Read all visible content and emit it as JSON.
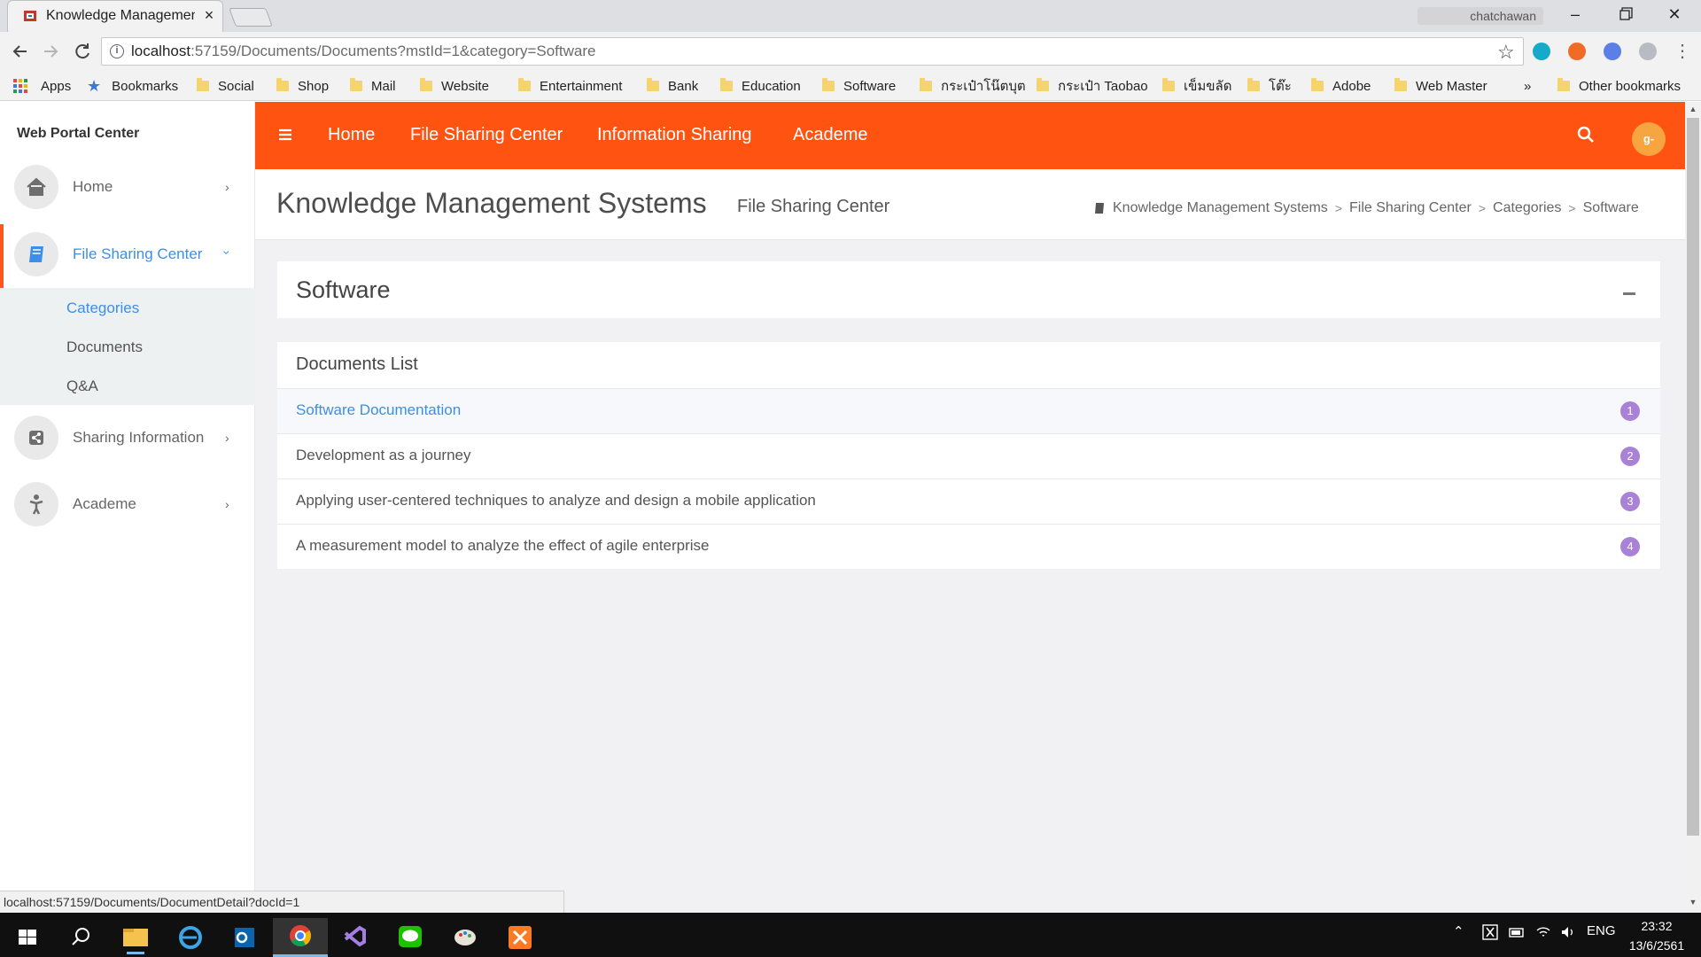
{
  "browser": {
    "tab_title": "Knowledge Management Systems",
    "tab_close": "×",
    "user": "chatchawan",
    "url_host": "localhost",
    "url_rest": ":57159/Documents/Documents?mstId=1&category=Software",
    "bookmarks": [
      "Apps",
      "Bookmarks",
      "Social",
      "Shop",
      "Mail",
      "Website",
      "Entertainment",
      "Bank",
      "Education",
      "Software",
      "กระเป๋าโน๊ตบุต",
      "กระเป๋า Taobao",
      "เข็มขลัด",
      "โต๊ะ",
      "Adobe",
      "Web Master"
    ],
    "more_bookmarks": "»",
    "other_bookmarks": "Other bookmarks",
    "status_url": "localhost:57159/Documents/DocumentDetail?docId=1"
  },
  "sidebar": {
    "brand": "Web Portal Center",
    "items": [
      {
        "label": "Home"
      },
      {
        "label": "File Sharing Center"
      },
      {
        "label": "Sharing Information"
      },
      {
        "label": "Academe"
      }
    ],
    "submenu": [
      "Categories",
      "Documents",
      "Q&A"
    ]
  },
  "topnav": {
    "links": [
      "Home",
      "File Sharing Center",
      "Information Sharing",
      "Academe"
    ],
    "avatar_text": "g-able"
  },
  "page": {
    "title": "Knowledge Management Systems",
    "subtitle": "File Sharing Center",
    "breadcrumb": [
      "Knowledge Management Systems",
      "File Sharing Center",
      "Categories",
      "Software"
    ],
    "breadcrumb_sep": ">"
  },
  "category_card": {
    "title": "Software"
  },
  "documents_card": {
    "title": "Documents List",
    "rows": [
      {
        "title": "Software Documentation",
        "badge": "1"
      },
      {
        "title": "Development as a journey",
        "badge": "2"
      },
      {
        "title": "Applying user-centered techniques to analyze and design a mobile application",
        "badge": "3"
      },
      {
        "title": "A measurement model to analyze the effect of agile enterprise",
        "badge": "4"
      }
    ]
  },
  "taskbar": {
    "lang": "ENG",
    "time": "23:32",
    "date": "13/6/2561"
  },
  "colors": {
    "accent": "#ff5312",
    "link": "#3d8ee8",
    "badge": "#a982d8"
  }
}
